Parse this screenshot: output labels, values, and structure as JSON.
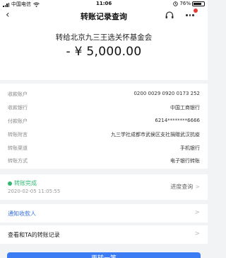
{
  "status_bar": {
    "carrier": "中国电信",
    "time": "11:06",
    "battery": "76%",
    "battery_level": 0.76
  },
  "nav": {
    "back_icon": "chevron-left",
    "title": "转账记录查询",
    "service_icon": "headset",
    "more_icon": "more-dots"
  },
  "header": {
    "recipient": "转给北京九三王选关怀基金会",
    "amount": "- ¥ 5,000.00"
  },
  "details": [
    {
      "label": "收款账户",
      "value": "0200 0029 0920 0173 252"
    },
    {
      "label": "收款银行",
      "value": "中国工商银行"
    },
    {
      "label": "付款账户",
      "value": "6214********6666"
    },
    {
      "label": "转账附言",
      "value": "九三学社成都市武侯区支社捐赠武汉抗疫"
    },
    {
      "label": "转账渠道",
      "value": "手机银行"
    },
    {
      "label": "转账方式",
      "value": "电子银行转账"
    }
  ],
  "status": {
    "label": "转账完成",
    "time": "2020-02-05 11:05:55",
    "progress_link": "进度查询",
    "color": "#2eb872"
  },
  "links": {
    "notify": "通知收款人",
    "records": "查看和TA的转账记录"
  },
  "bottom_button": {
    "label": "再转一笔",
    "color": "#3b7cf5"
  }
}
